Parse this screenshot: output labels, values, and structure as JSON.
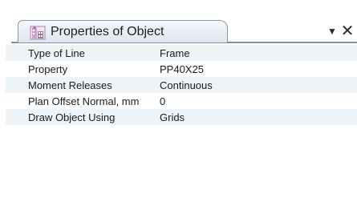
{
  "panel": {
    "title": "Properties of Object",
    "icon": "building-properties-icon",
    "menu_icon": "dropdown-arrow-icon",
    "menu_glyph": "▼",
    "close_icon": "close-icon",
    "close_glyph": "✕"
  },
  "properties": [
    {
      "name": "Type of Line",
      "value": "Frame"
    },
    {
      "name": "Property",
      "value": "PP40X25"
    },
    {
      "name": "Moment Releases",
      "value": "Continuous"
    },
    {
      "name": "Plan Offset Normal, mm",
      "value": "0"
    },
    {
      "name": "Draw Object Using",
      "value": "Grids"
    }
  ],
  "colors": {
    "tab_border": "#8796aa",
    "header_rule": "#7f8fa5",
    "alt_row": "#eef3f7"
  }
}
